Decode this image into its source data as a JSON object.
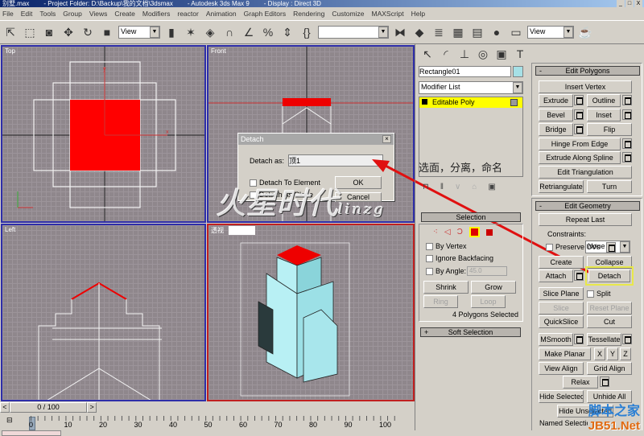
{
  "titlebar": {
    "file": "别墅.max",
    "project": "- Project Folder: D:\\Backup\\我的文档\\3dsmax",
    "app": "- Autodesk 3ds Max 9",
    "display": "- Display : Direct 3D",
    "controls": [
      "_",
      "□",
      "X"
    ]
  },
  "menu": [
    "File",
    "Edit",
    "Tools",
    "Group",
    "Views",
    "Create",
    "Modifiers",
    "reactor",
    "Animation",
    "Graph Editors",
    "Rendering",
    "Customize",
    "MAXScript",
    "Help"
  ],
  "toolbar": {
    "ref_coord": "View",
    "named_sel": "",
    "view2": "View",
    "icons": [
      "select-region-icon",
      "rect-select-icon",
      "window-crossing-icon",
      "move-icon",
      "rotate-icon",
      "scale-icon",
      "pivot-icon",
      "manipulate-icon",
      "keyboard-icon",
      "snap3-icon",
      "angle-snap-icon",
      "percent-snap-icon",
      "spinner-snap-icon",
      "edit-named-sel-icon",
      "mirror-icon",
      "align-icon",
      "layer-icon",
      "curve-editor-icon",
      "schematic-icon",
      "material-editor-icon",
      "render-scene-icon",
      "quick-render-icon"
    ]
  },
  "viewports": [
    {
      "label": "Top"
    },
    {
      "label": "Front"
    },
    {
      "label": "Left"
    },
    {
      "label": "透视"
    }
  ],
  "dialog": {
    "title": "Detach",
    "detach_as_label": "Detach as:",
    "detach_as_value": "顶1",
    "to_element": "Detach To Element",
    "as_clone": "Detach As Clone",
    "ok": "OK",
    "cancel": "Cancel",
    "close": "×"
  },
  "overlay": {
    "logo": "火星时代",
    "logo_en": "linzg"
  },
  "annotation": "选面，分离，命名",
  "command_panel": {
    "object_name": "Rectangle01",
    "object_color": "#a6e0e6",
    "modifier_list": "Modifier List",
    "stack": [
      {
        "label": "Editable Poly"
      }
    ],
    "selection": {
      "title": "Selection",
      "by_vertex": "By Vertex",
      "ignore_backfacing": "Ignore Backfacing",
      "by_angle": "By Angle:",
      "angle_value": "45.0",
      "shrink": "Shrink",
      "grow": "Grow",
      "ring": "Ring",
      "loop": "Loop",
      "status": "4 Polygons Selected"
    },
    "soft_selection": {
      "title": "Soft Selection",
      "toggle": "+"
    },
    "edit_polygons": {
      "title": "Edit Polygons",
      "toggle": "-",
      "insert_vertex": "Insert Vertex",
      "extrude": "Extrude",
      "outline": "Outline",
      "bevel": "Bevel",
      "inset": "Inset",
      "bridge": "Bridge",
      "flip": "Flip",
      "hinge": "Hinge From Edge",
      "extrude_spline": "Extrude Along Spline",
      "edit_tri": "Edit Triangulation",
      "retri": "Retriangulate",
      "turn": "Turn"
    },
    "edit_geometry": {
      "title": "Edit Geometry",
      "toggle": "-",
      "repeat_last": "Repeat Last",
      "constraints_label": "Constraints:",
      "constraints_value": "None",
      "preserve_uvs": "Preserve UVs",
      "create": "Create",
      "collapse": "Collapse",
      "attach": "Attach",
      "detach": "Detach",
      "slice_plane": "Slice Plane",
      "split": "Split",
      "slice": "Slice",
      "reset_plane": "Reset Plane",
      "quickslice": "QuickSlice",
      "cut": "Cut",
      "msmooth": "MSmooth",
      "tessellate": "Tessellate",
      "make_planar": "Make Planar",
      "x": "X",
      "y": "Y",
      "z": "Z",
      "view_align": "View Align",
      "grid_align": "Grid Align",
      "relax": "Relax",
      "hide_selected": "Hide Selected",
      "unhide_all": "Unhide All",
      "hide_unselected": "Hide Unselected",
      "named_selections": "Named Selections:"
    }
  },
  "timeline": {
    "frame": "0 / 100",
    "prev": "<",
    "next": ">",
    "ticks": [
      "0",
      "10",
      "20",
      "30",
      "40",
      "50",
      "60",
      "70",
      "80",
      "90",
      "100"
    ]
  },
  "watermark": {
    "cn": "脚本之家",
    "en": "JB51.Net"
  },
  "colors": {
    "selection_red": "#ff0000",
    "highlight_yellow": "#ffff00",
    "viewport_active": "#c02020",
    "viewport": "#2e2ea8"
  }
}
